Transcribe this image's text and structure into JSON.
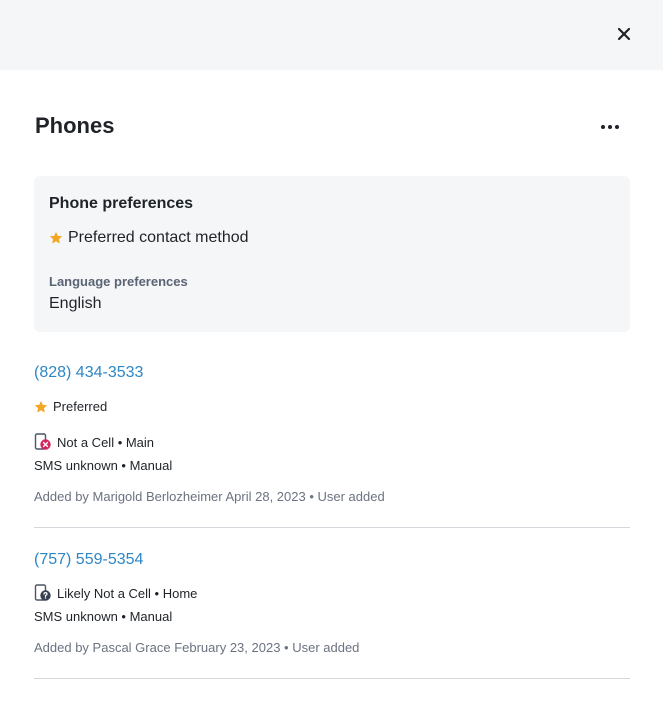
{
  "header": {
    "close_icon": "close-icon"
  },
  "panel": {
    "title": "Phones",
    "more_icon": "more-horizontal-icon"
  },
  "phone_preferences": {
    "title": "Phone preferences",
    "preferred_label": "Preferred contact method",
    "language_label": "Language preferences",
    "language_value": "English"
  },
  "phones": [
    {
      "number": "(828) 434-3533",
      "preferred_label": "Preferred",
      "type_text": "Not a Cell • Main",
      "sms_text": "SMS unknown • Manual",
      "added_text": "Added by Marigold Berlozheimer April 28, 2023 • User added",
      "type_icon": "not-cell-phone-icon"
    },
    {
      "number": "(757) 559-5354",
      "type_text": "Likely Not a Cell • Home",
      "sms_text": "SMS unknown • Manual",
      "added_text": "Added by Pascal Grace February 23, 2023 • User added",
      "type_icon": "unknown-cell-phone-icon"
    }
  ],
  "colors": {
    "accent_link": "#2d86c6",
    "star": "#f5a623",
    "error_badge": "#d6245f",
    "panel_bg": "#f5f6f8"
  }
}
